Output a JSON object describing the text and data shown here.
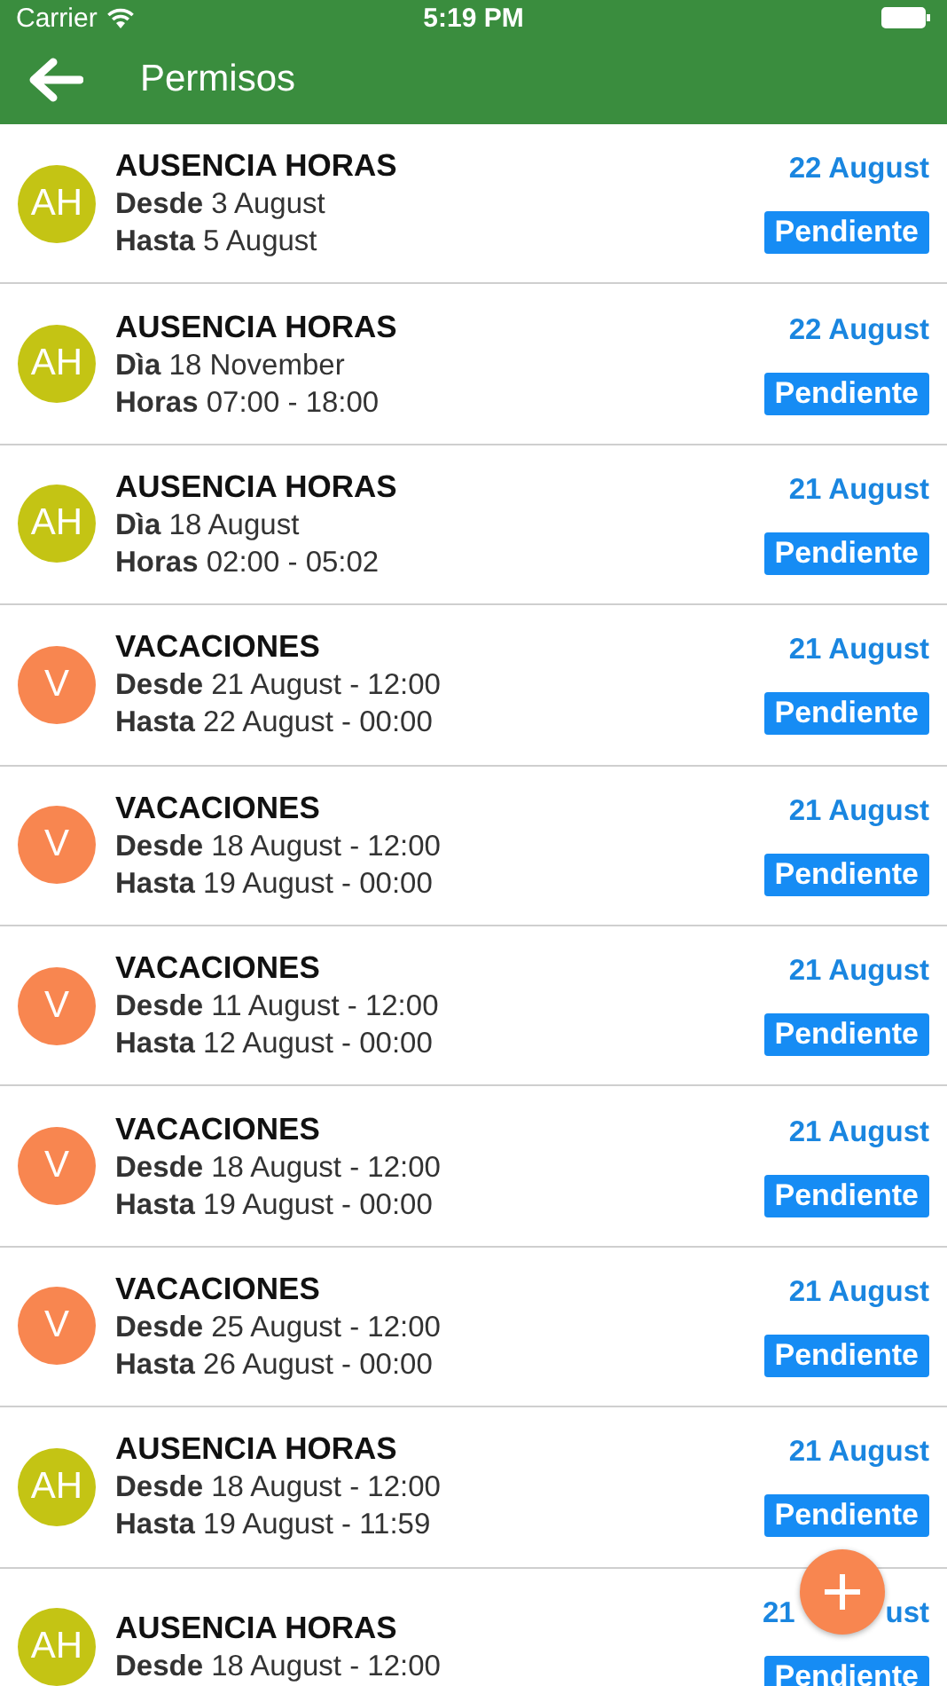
{
  "status_bar": {
    "carrier": "Carrier",
    "time": "5:19 PM"
  },
  "nav": {
    "title": "Permisos"
  },
  "items": [
    {
      "initials": "AH",
      "color": "#c4c414",
      "title": "AUSENCIA HORAS",
      "lines": [
        {
          "label": "Desde",
          "value": "3 August"
        },
        {
          "label": "Hasta",
          "value": "5 August"
        }
      ],
      "date": "22 August",
      "status": "Pendiente"
    },
    {
      "initials": "AH",
      "color": "#c4c414",
      "title": "AUSENCIA HORAS",
      "lines": [
        {
          "label": "Dìa",
          "value": "18 November"
        },
        {
          "label": "Horas",
          "value": "07:00 - 18:00"
        }
      ],
      "date": "22 August",
      "status": "Pendiente"
    },
    {
      "initials": "AH",
      "color": "#c4c414",
      "title": "AUSENCIA HORAS",
      "lines": [
        {
          "label": "Dìa",
          "value": "18 August"
        },
        {
          "label": "Horas",
          "value": "02:00 - 05:02"
        }
      ],
      "date": "21 August",
      "status": "Pendiente"
    },
    {
      "initials": "V",
      "color": "#f88650",
      "title": "VACACIONES",
      "lines": [
        {
          "label": "Desde",
          "value": "21 August - 12:00"
        },
        {
          "label": "Hasta",
          "value": "22 August - 00:00"
        }
      ],
      "date": "21 August",
      "status": "Pendiente"
    },
    {
      "initials": "V",
      "color": "#f88650",
      "title": "VACACIONES",
      "lines": [
        {
          "label": "Desde",
          "value": "18 August - 12:00"
        },
        {
          "label": "Hasta",
          "value": "19 August - 00:00"
        }
      ],
      "date": "21 August",
      "status": "Pendiente"
    },
    {
      "initials": "V",
      "color": "#f88650",
      "title": "VACACIONES",
      "lines": [
        {
          "label": "Desde",
          "value": "11 August - 12:00"
        },
        {
          "label": "Hasta",
          "value": "12 August - 00:00"
        }
      ],
      "date": "21 August",
      "status": "Pendiente"
    },
    {
      "initials": "V",
      "color": "#f88650",
      "title": "VACACIONES",
      "lines": [
        {
          "label": "Desde",
          "value": "18 August - 12:00"
        },
        {
          "label": "Hasta",
          "value": "19 August - 00:00"
        }
      ],
      "date": "21 August",
      "status": "Pendiente"
    },
    {
      "initials": "V",
      "color": "#f88650",
      "title": "VACACIONES",
      "lines": [
        {
          "label": "Desde",
          "value": "25 August - 12:00"
        },
        {
          "label": "Hasta",
          "value": "26 August - 00:00"
        }
      ],
      "date": "21 August",
      "status": "Pendiente"
    },
    {
      "initials": "AH",
      "color": "#c4c414",
      "title": "AUSENCIA HORAS",
      "lines": [
        {
          "label": "Desde",
          "value": "18 August - 12:00"
        },
        {
          "label": "Hasta",
          "value": "19 August - 11:59"
        }
      ],
      "date": "21 August",
      "status": "Pendiente"
    },
    {
      "initials": "AH",
      "color": "#c4c414",
      "title": "AUSENCIA HORAS",
      "lines": [
        {
          "label": "Desde",
          "value": "18 August - 12:00"
        }
      ],
      "date_fragments": [
        "21",
        "ust"
      ],
      "status": "Pendiente"
    }
  ]
}
